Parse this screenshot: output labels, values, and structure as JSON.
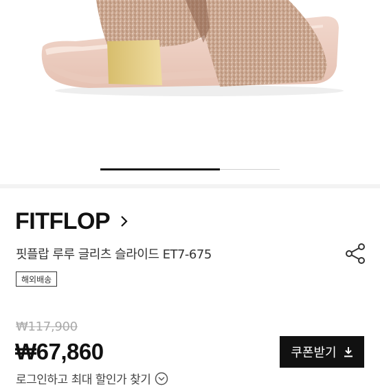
{
  "product": {
    "brand": "FITFLOP",
    "title": "핏플랍 루루 글리츠 슬라이드 ET7-675",
    "badge": "해외배송"
  },
  "carousel": {
    "progress": 0.667
  },
  "pricing": {
    "original_price": "₩117,900",
    "sale_price": "₩67,860"
  },
  "actions": {
    "coupon_label": "쿠폰받기",
    "login_discount_label": "로그인하고 최대 할인가 찾기"
  },
  "icons": {
    "brand_chevron": "chevron-right-icon",
    "share": "share-icon",
    "coupon": "download-icon",
    "login": "chevron-down-circle-icon"
  },
  "colors": {
    "primary": "#111111",
    "badge_border": "#333333",
    "muted_price": "#aaaaaa"
  }
}
